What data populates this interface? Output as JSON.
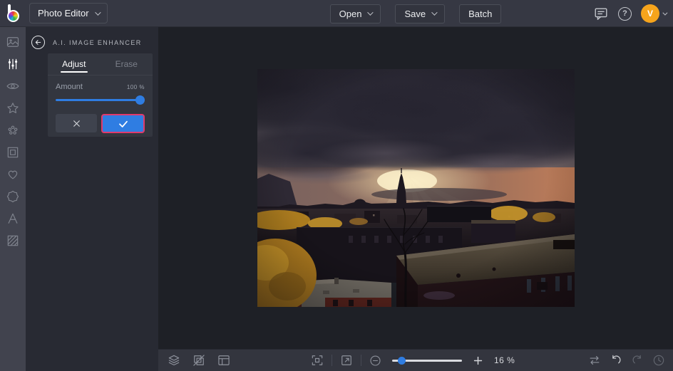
{
  "topbar": {
    "app_menu_label": "Photo Editor",
    "open_label": "Open",
    "save_label": "Save",
    "batch_label": "Batch",
    "avatar_initial": "V"
  },
  "sidebar": {
    "items": [
      {
        "icon": "image-edit-icon",
        "active": false
      },
      {
        "icon": "adjust-sliders-icon",
        "active": true
      },
      {
        "icon": "touchup-eye-icon",
        "active": false
      },
      {
        "icon": "effects-star-icon",
        "active": false
      },
      {
        "icon": "artsy-icon",
        "active": false
      },
      {
        "icon": "frames-icon",
        "active": false
      },
      {
        "icon": "overlays-heart-icon",
        "active": false
      },
      {
        "icon": "graphics-badge-icon",
        "active": false
      },
      {
        "icon": "text-icon",
        "active": false
      },
      {
        "icon": "textures-icon",
        "active": false
      }
    ]
  },
  "panel": {
    "title": "A.I. IMAGE ENHANCER",
    "tabs": [
      {
        "label": "Adjust",
        "active": true
      },
      {
        "label": "Erase",
        "active": false
      }
    ],
    "amount_label": "Amount",
    "amount_value": "100 %",
    "amount_percent": 100,
    "cancel_icon": "x-icon",
    "apply_icon": "checkmark-icon"
  },
  "toolbar": {
    "left_icons": [
      "layers-icon",
      "transform-icon",
      "canvas-icon"
    ],
    "center_icons": [
      "fit-screen-icon",
      "fullscreen-icon",
      "zoom-out-icon",
      "zoom-slider",
      "zoom-in-icon"
    ],
    "right_icons": [
      "compare-icon",
      "undo-icon",
      "redo-icon",
      "history-icon"
    ],
    "zoom_value": "16 %",
    "zoom_percent": 16
  },
  "canvas": {
    "photo_description": "city skyline under dramatic storm clouds with sunbeams"
  },
  "colors": {
    "accent_blue": "#2f7de2",
    "highlight_pink": "#e13a6c",
    "avatar_orange": "#f6a41c"
  }
}
